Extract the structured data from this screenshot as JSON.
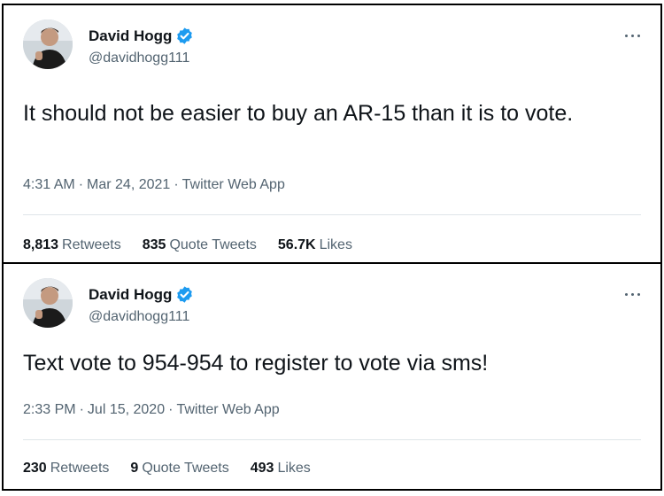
{
  "colors": {
    "accent": "#1d9bf0",
    "text": "#0f1419",
    "muted": "#536471",
    "divider": "#dfe5e9"
  },
  "tweets": [
    {
      "author": {
        "name": "David Hogg",
        "handle": "@davidhogg111",
        "verified": true,
        "verified_icon": "verified-badge-icon"
      },
      "text": "It should not be easier to buy an AR-15 than it is to vote.",
      "time": "4:31 AM",
      "date": "Mar 24, 2021",
      "source": "Twitter Web App",
      "separator": "·",
      "stats": {
        "retweets": {
          "count": "8,813",
          "label": "Retweets"
        },
        "quotes": {
          "count": "835",
          "label": "Quote Tweets"
        },
        "likes": {
          "count": "56.7K",
          "label": "Likes"
        }
      }
    },
    {
      "author": {
        "name": "David Hogg",
        "handle": "@davidhogg111",
        "verified": true,
        "verified_icon": "verified-badge-icon"
      },
      "text": "Text vote to 954-954 to register to vote via sms!",
      "time": "2:33 PM",
      "date": "Jul 15, 2020",
      "source": "Twitter Web App",
      "separator": "·",
      "stats": {
        "retweets": {
          "count": "230",
          "label": "Retweets"
        },
        "quotes": {
          "count": "9",
          "label": "Quote Tweets"
        },
        "likes": {
          "count": "493",
          "label": "Likes"
        }
      }
    }
  ]
}
